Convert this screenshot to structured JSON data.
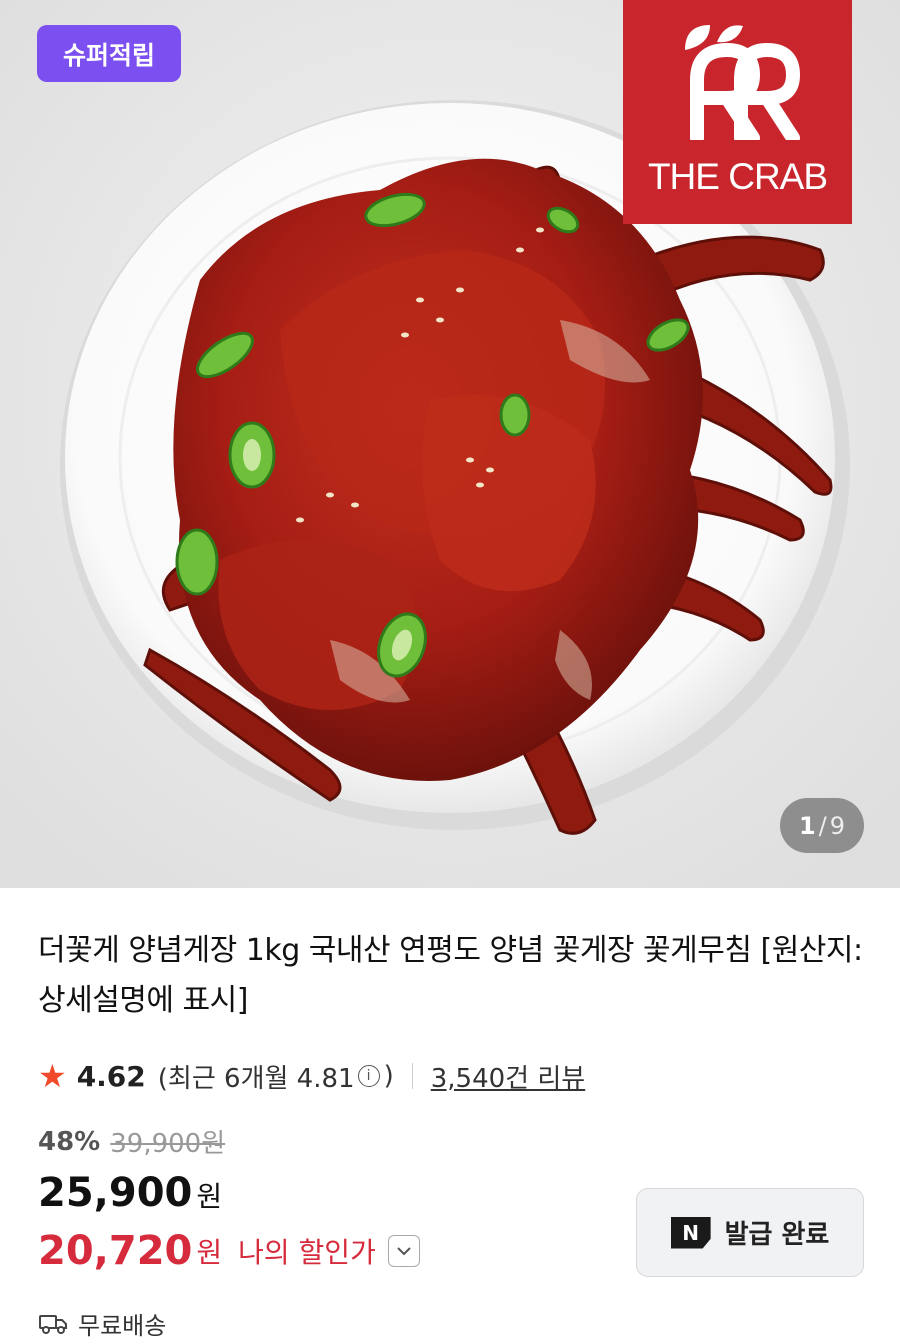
{
  "hero": {
    "badge": "슈퍼적립",
    "brand": "THE CRAB",
    "counter": {
      "current": "1",
      "separator": "/",
      "total": "9"
    }
  },
  "product": {
    "title": "더꽃게 양념게장 1kg 국내산 연평도 양념 꽃게장 꽃게무침 [원산지:상세설명에 표시]",
    "rating": {
      "score": "4.62",
      "recent_prefix": "(최근 6개월 4.81",
      "recent_suffix": ")",
      "review_count": "3,540건 리뷰"
    },
    "pricing": {
      "discount": "48%",
      "original_price": "39,900원",
      "price": "25,900",
      "price_unit": "원",
      "my_price": "20,720",
      "my_price_unit": "원",
      "my_price_label": "나의 할인가"
    },
    "coupon": {
      "icon_text": "N",
      "label": "발급 완료"
    },
    "shipping": "무료배송"
  },
  "colors": {
    "badge": "#7b4ff0",
    "brand": "#c8262c",
    "star": "#f04a2a",
    "discount_price": "#d62b3c"
  },
  "icons": [
    "star-icon",
    "info-icon",
    "chevron-down-icon",
    "naver-n-icon",
    "truck-icon"
  ]
}
